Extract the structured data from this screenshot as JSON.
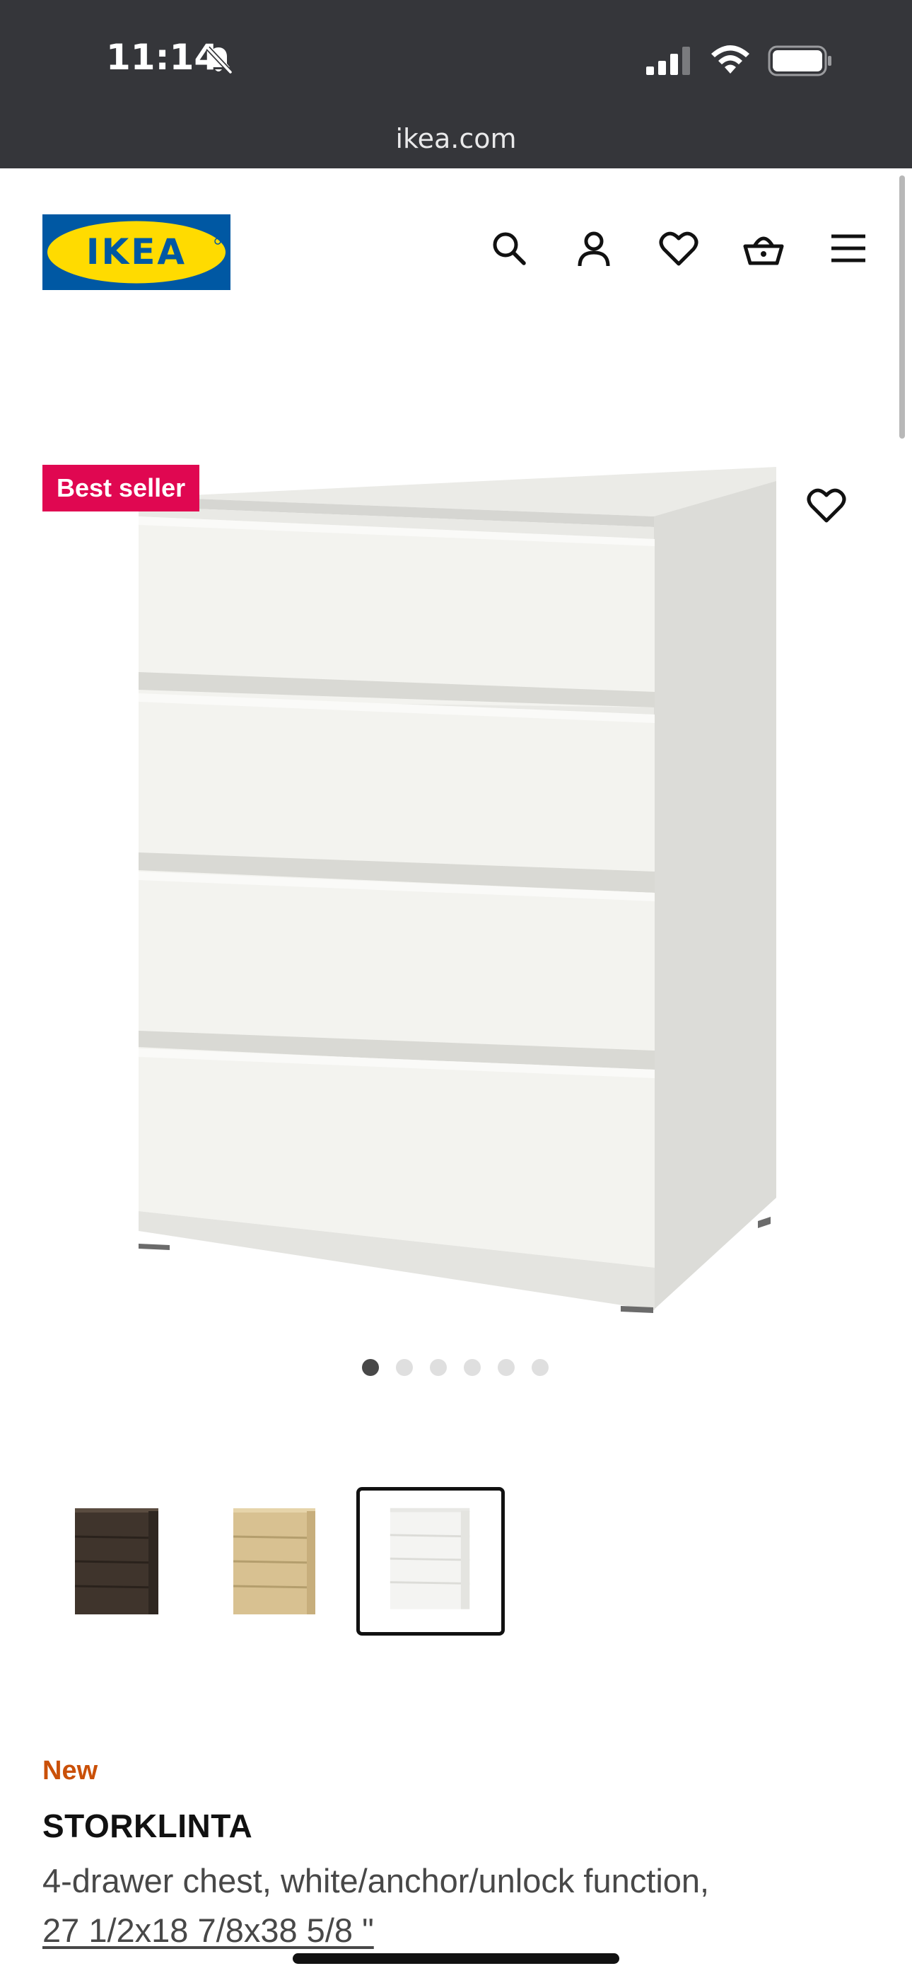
{
  "status_bar": {
    "time": "11:14",
    "icons": [
      "bell-slash-icon",
      "signal-icon",
      "wifi-icon",
      "battery-icon"
    ]
  },
  "browser": {
    "url": "ikea.com"
  },
  "header": {
    "logo_text": "IKEA",
    "icons": [
      "search-icon",
      "account-icon",
      "favorites-icon",
      "cart-icon",
      "menu-icon"
    ]
  },
  "product_media": {
    "badge": "Best seller",
    "favorite_icon": "heart-icon",
    "carousel": {
      "total": 6,
      "active_index": 0
    }
  },
  "variants": [
    {
      "color_name": "black-brown",
      "swatch": "#4a3d33",
      "selected": false
    },
    {
      "color_name": "oak effect",
      "swatch": "#d8c191",
      "selected": false
    },
    {
      "color_name": "white",
      "swatch": "#f4f4f2",
      "selected": true
    }
  ],
  "product": {
    "tag": "New",
    "name": "STORKLINTA",
    "description": "4-drawer chest, white/anchor/unlock function,",
    "dimensions": "27 1/2x18 7/8x38 5/8 \""
  },
  "colors": {
    "status_bar_bg": "#35363a",
    "badge_bg": "#e00751",
    "new_tag": "#ca5008",
    "ikea_blue": "#0058a3",
    "ikea_yellow": "#ffdb00"
  }
}
